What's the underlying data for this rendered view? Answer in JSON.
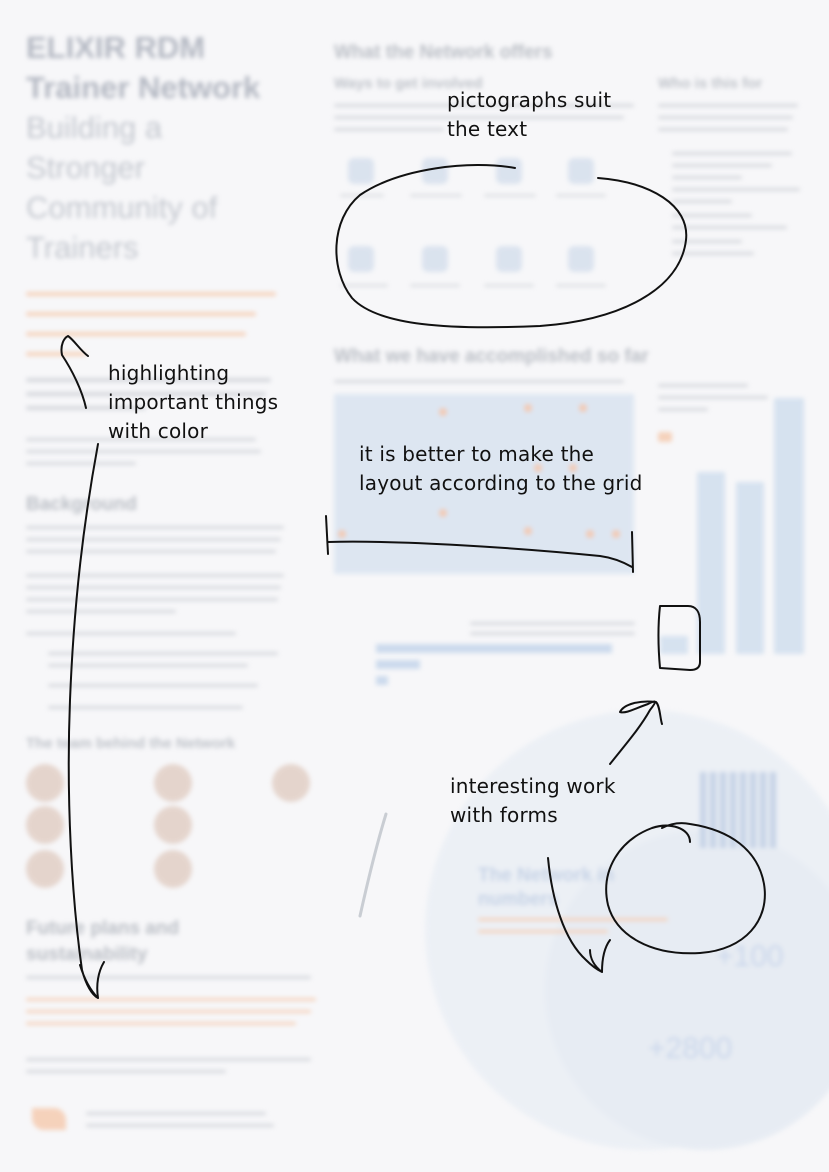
{
  "poster": {
    "title": [
      "ELIXIR RDM",
      "Trainer Network"
    ],
    "subtitle": [
      "Building a",
      "Stronger",
      "Community of",
      "Trainers"
    ],
    "sections": {
      "offers": "What the Network offers",
      "ways": "Ways to get involved",
      "who": "Who is this for",
      "accomplished": "What we have accomplished so far",
      "background": "Background",
      "team": "The team behind the Network",
      "future": [
        "Future plans and",
        "sustainability"
      ],
      "numbers": [
        "The Network in",
        "numbers"
      ]
    },
    "stats": [
      "+100",
      "+2800"
    ]
  },
  "annotations": {
    "pictographs": [
      "pictographs suit",
      "the text"
    ],
    "highlighting": [
      "highlighting",
      "important things",
      "with color"
    ],
    "grid": [
      "it is better to make the",
      "layout according to the grid"
    ],
    "forms": [
      "interesting work",
      "with forms"
    ]
  },
  "colors": {
    "accent": "#f2a06a",
    "blue": "#bcd1e8",
    "ink": "#111111"
  }
}
